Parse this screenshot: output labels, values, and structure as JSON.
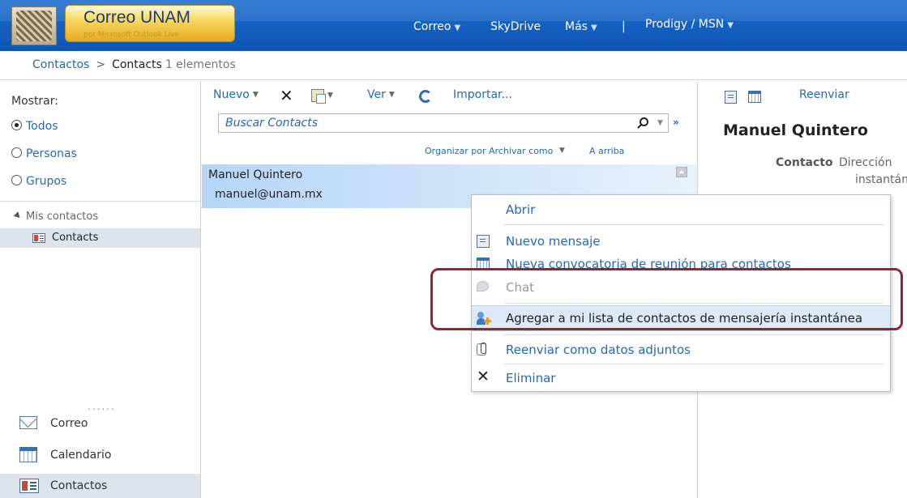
{
  "header": {
    "brand_title": "Correo UNAM",
    "brand_subtitle": "por Microsoft Outlook Live",
    "nav": [
      {
        "label": "Correo",
        "has_caret": true
      },
      {
        "label": "SkyDrive",
        "has_caret": false
      },
      {
        "label": "Más",
        "has_caret": true
      },
      {
        "label": "|",
        "has_caret": false
      },
      {
        "label": "Prodigy / MSN",
        "has_caret": true
      }
    ]
  },
  "breadcrumb": {
    "parent": "Contactos",
    "separator": ">",
    "current": "Contacts",
    "count": "1 elementos"
  },
  "sidebar": {
    "show_label": "Mostrar:",
    "filters": [
      {
        "label": "Todos",
        "selected": true
      },
      {
        "label": "Personas",
        "selected": false
      },
      {
        "label": "Grupos",
        "selected": false
      }
    ],
    "my_contacts_label": "Mis contactos",
    "folder_label": "Contacts",
    "more_dots": "......",
    "apps": [
      {
        "label": "Correo",
        "icon": "mail-icon",
        "selected": false
      },
      {
        "label": "Calendario",
        "icon": "calendar-icon",
        "selected": false
      },
      {
        "label": "Contactos",
        "icon": "contact-card-icon",
        "selected": true
      }
    ]
  },
  "toolbar": {
    "new_label": "Nuevo",
    "delete_icon": "close-icon",
    "move_icon": "paste-icon",
    "view_label": "Ver",
    "sync_icon": "sync-icon",
    "import_label": "Importar..."
  },
  "search": {
    "placeholder": "Buscar Contacts"
  },
  "sort": {
    "arrange_label": "Organizar por Archivar como",
    "order_label": "A arriba"
  },
  "contact_list": [
    {
      "name": "Manuel Quintero",
      "email": "manuel@unam.mx"
    }
  ],
  "reading_pane": {
    "forward_label": "Reenviar",
    "contact_name": "Manuel Quintero",
    "field_label": "Contacto",
    "field_value_line1": "Dirección",
    "field_value_line2": "instantán"
  },
  "context_menu": {
    "items": [
      {
        "label": "Abrir",
        "icon": "",
        "enabled": true
      },
      {
        "label": "Nuevo mensaje",
        "icon": "new-message-icon",
        "enabled": true
      },
      {
        "label": "Nueva convocatoria de reunión para contactos",
        "icon": "calendar-icon",
        "enabled": true
      },
      {
        "label": "Chat",
        "icon": "chat-icon",
        "enabled": false
      },
      {
        "label": "Agregar a mi lista de contactos de mensajería instantánea",
        "icon": "add-contact-icon",
        "enabled": true,
        "highlighted": true
      },
      {
        "label": "Reenviar como datos adjuntos",
        "icon": "attachment-icon",
        "enabled": true
      },
      {
        "label": "Eliminar",
        "icon": "close-icon",
        "enabled": true
      }
    ]
  },
  "colors": {
    "header_blue": "#1561c2",
    "link_blue": "#2468b7",
    "selection_blue": "#b5d6f7",
    "annotation_red": "#8b2a2a",
    "brand_gold": "#f7dc6a"
  }
}
